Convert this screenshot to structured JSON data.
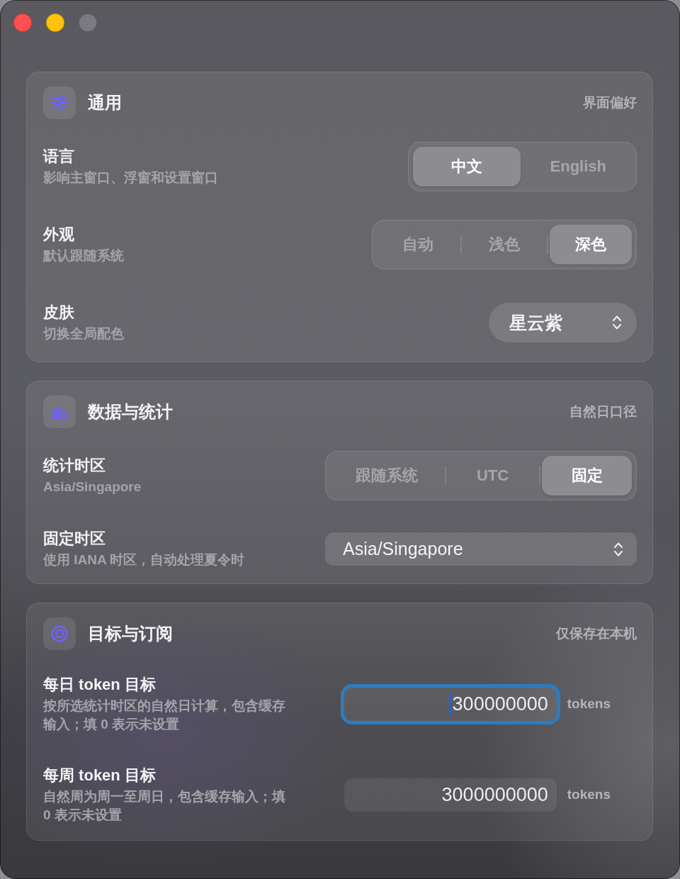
{
  "window": {
    "buttons": [
      {
        "kind": "close",
        "disabled": false
      },
      {
        "kind": "minimize",
        "disabled": false
      },
      {
        "kind": "zoom",
        "disabled": true
      }
    ]
  },
  "sections": [
    {
      "title": "通用",
      "note": "界面偏好",
      "rows": [
        {
          "kind": "segmented",
          "label": "语言",
          "description": "影响主窗口、浮窗和设置窗口",
          "options": [
            {
              "label": "中文",
              "selected": true
            },
            {
              "label": "English",
              "selected": false
            }
          ]
        },
        {
          "kind": "segmented",
          "label": "外观",
          "description": "默认跟随系统",
          "options": [
            {
              "label": "自动",
              "selected": false
            },
            {
              "label": "浅色",
              "selected": false
            },
            {
              "label": "深色",
              "selected": true
            }
          ]
        },
        {
          "kind": "popup",
          "label": "皮肤",
          "description": "切换全局配色",
          "value": "星云紫"
        }
      ]
    },
    {
      "title": "数据与统计",
      "note": "自然日口径",
      "rows": [
        {
          "kind": "segmented",
          "label": "统计时区",
          "description": "Asia/Singapore",
          "options": [
            {
              "label": "跟随系统",
              "selected": false
            },
            {
              "label": "UTC",
              "selected": false
            },
            {
              "label": "固定",
              "selected": true
            }
          ]
        },
        {
          "kind": "dropdown",
          "label": "固定时区",
          "description": "使用 IANA 时区，自动处理夏令时",
          "value": "Asia/Singapore"
        }
      ]
    },
    {
      "title": "目标与订阅",
      "note": "仅保存在本机",
      "rows": [
        {
          "kind": "number",
          "label": "每日 token 目标",
          "description": "按所选统计时区的自然日计算，包含缓存输入；填 0 表示未设置",
          "value": "300000000",
          "unit": "tokens",
          "focused": true
        },
        {
          "kind": "number",
          "label": "每周 token 目标",
          "description": "自然周为周一至周日，包含缓存输入；填 0 表示未设置",
          "value": "3000000000",
          "unit": "tokens",
          "focused": false
        }
      ]
    }
  ]
}
